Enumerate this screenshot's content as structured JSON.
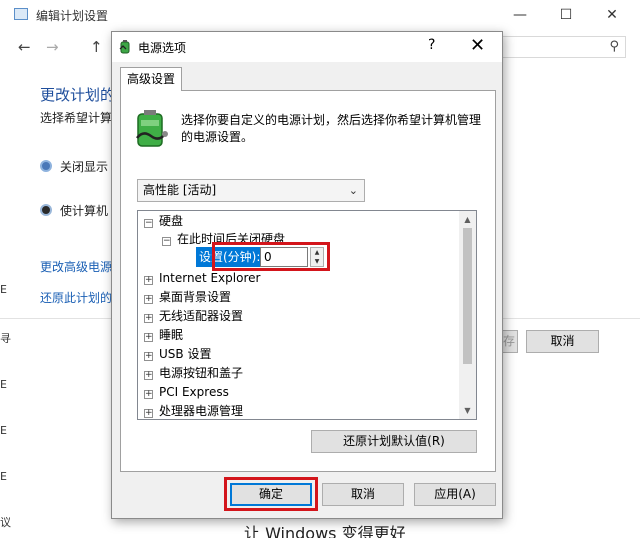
{
  "background_window": {
    "title": "编辑计划设置",
    "controls": {
      "minimize": "—",
      "maximize": "☐",
      "close": "✕"
    },
    "nav": {
      "back": "←",
      "forward": "→",
      "up": "↑"
    },
    "search_icon": "search-icon",
    "heading": "更改计划的",
    "subtitle": "选择希望计算",
    "options": [
      {
        "label": "关闭显示",
        "icon": "monitor-icon"
      },
      {
        "label": "使计算机",
        "icon": "moon-icon"
      }
    ],
    "links": [
      "更改高级电源",
      "还原此计划的"
    ],
    "buttons": [
      "保存",
      "取消"
    ],
    "edge_fragments": [
      "E",
      "寻",
      "E",
      "E",
      "E",
      "议"
    ],
    "footer_text": "让 Windows 变得更好"
  },
  "dialog": {
    "title": "电源选项",
    "help_label": "?",
    "close_label": "✕",
    "tab_label": "高级设置",
    "description": "选择你要自定义的电源计划，然后选择你希望计算机管理的电源设置。",
    "plan_select": {
      "value": "高性能 [活动]"
    },
    "tree": {
      "items": [
        {
          "label": "硬盘",
          "expander": "⊟",
          "level": 0
        },
        {
          "label": "在此时间后关闭硬盘",
          "expander": "⊟",
          "level": 1
        },
        {
          "label": "Internet Explorer",
          "expander": "⊞",
          "level": 0
        },
        {
          "label": "桌面背景设置",
          "expander": "⊞",
          "level": 0
        },
        {
          "label": "无线适配器设置",
          "expander": "⊞",
          "level": 0
        },
        {
          "label": "睡眠",
          "expander": "⊞",
          "level": 0
        },
        {
          "label": "USB 设置",
          "expander": "⊞",
          "level": 0
        },
        {
          "label": "电源按钮和盖子",
          "expander": "⊞",
          "level": 0
        },
        {
          "label": "PCI Express",
          "expander": "⊞",
          "level": 0
        },
        {
          "label": "处理器电源管理",
          "expander": "⊞",
          "level": 0
        }
      ],
      "setting_label": "设置(分钟):",
      "setting_value": "0"
    },
    "restore_button": "还原计划默认值(R)",
    "ok_button": "确定",
    "cancel_button": "取消",
    "apply_button": "应用(A)"
  },
  "colors": {
    "highlight_red": "#d3151b",
    "selection_blue": "#0078d7",
    "link_blue": "#1a5fb4"
  }
}
